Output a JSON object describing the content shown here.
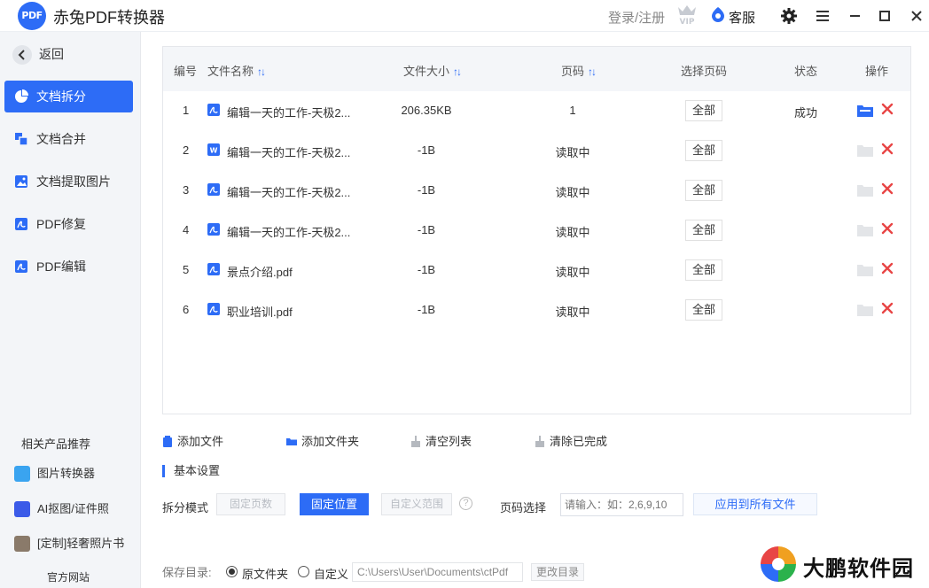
{
  "app": {
    "logo_text": "PDF",
    "title": "赤兔PDF转换器",
    "login_label": "登录/注册",
    "vip_label": "VIP",
    "service_label": "客服"
  },
  "sidebar": {
    "back_label": "返回",
    "items": [
      {
        "label": "文档拆分",
        "icon": "pie-chart-icon",
        "active": true
      },
      {
        "label": "文档合并",
        "icon": "merge-icon",
        "active": false
      },
      {
        "label": "文档提取图片",
        "icon": "image-icon",
        "active": false
      },
      {
        "label": "PDF修复",
        "icon": "pdf-icon",
        "active": false
      },
      {
        "label": "PDF编辑",
        "icon": "pdf-icon",
        "active": false
      }
    ],
    "related_title": "相关产品推荐",
    "products": [
      {
        "label": "图片转换器",
        "icon": "image-converter-icon"
      },
      {
        "label": "AI抠图/证件照",
        "icon": "ai-cutout-icon"
      },
      {
        "label": "[定制]轻奢照片书",
        "icon": "photobook-icon"
      }
    ],
    "website_label": "官方网站"
  },
  "table": {
    "headers": {
      "index": "编号",
      "name": "文件名称",
      "size": "文件大小",
      "pages": "页码",
      "select_pages": "选择页码",
      "status": "状态",
      "actions": "操作"
    },
    "rows": [
      {
        "index": "1",
        "type": "pdf",
        "name": "编辑一天的工作-天极2...",
        "size": "206.35KB",
        "pages": "1",
        "select": "全部",
        "status": "成功",
        "folder_enabled": true
      },
      {
        "index": "2",
        "type": "word",
        "name": "编辑一天的工作-天极2...",
        "size": "-1B",
        "pages": "读取中",
        "select": "全部",
        "status": "",
        "folder_enabled": false
      },
      {
        "index": "3",
        "type": "pdf",
        "name": "编辑一天的工作-天极2...",
        "size": "-1B",
        "pages": "读取中",
        "select": "全部",
        "status": "",
        "folder_enabled": false
      },
      {
        "index": "4",
        "type": "pdf",
        "name": "编辑一天的工作-天极2...",
        "size": "-1B",
        "pages": "读取中",
        "select": "全部",
        "status": "",
        "folder_enabled": false
      },
      {
        "index": "5",
        "type": "pdf",
        "name": "景点介绍.pdf",
        "size": "-1B",
        "pages": "读取中",
        "select": "全部",
        "status": "",
        "folder_enabled": false
      },
      {
        "index": "6",
        "type": "pdf",
        "name": "职业培训.pdf",
        "size": "-1B",
        "pages": "读取中",
        "select": "全部",
        "status": "",
        "folder_enabled": false
      }
    ]
  },
  "toolbar": {
    "add_file": "添加文件",
    "add_folder": "添加文件夹",
    "clear_list": "清空列表",
    "clear_done": "清除已完成"
  },
  "settings": {
    "title": "基本设置",
    "split_mode_label": "拆分模式",
    "mode_fixed_pages": "固定页数",
    "mode_fixed_position": "固定位置",
    "mode_custom_range": "自定义范围",
    "help": "?",
    "page_select_label": "页码选择",
    "page_select_placeholder": "请输入：如：2,6,9,10",
    "apply_all": "应用到所有文件",
    "save_dir_label": "保存目录:",
    "opt_original": "原文件夹",
    "opt_custom": "自定义",
    "path_value": "C:\\Users\\User\\Documents\\ctPdf",
    "change_dir": "更改目录"
  },
  "watermark": {
    "text": "大鹏软件园"
  },
  "colors": {
    "accent": "#2d6cf6",
    "delete": "#e84545",
    "sidebar_bg": "#f3f5f8"
  }
}
